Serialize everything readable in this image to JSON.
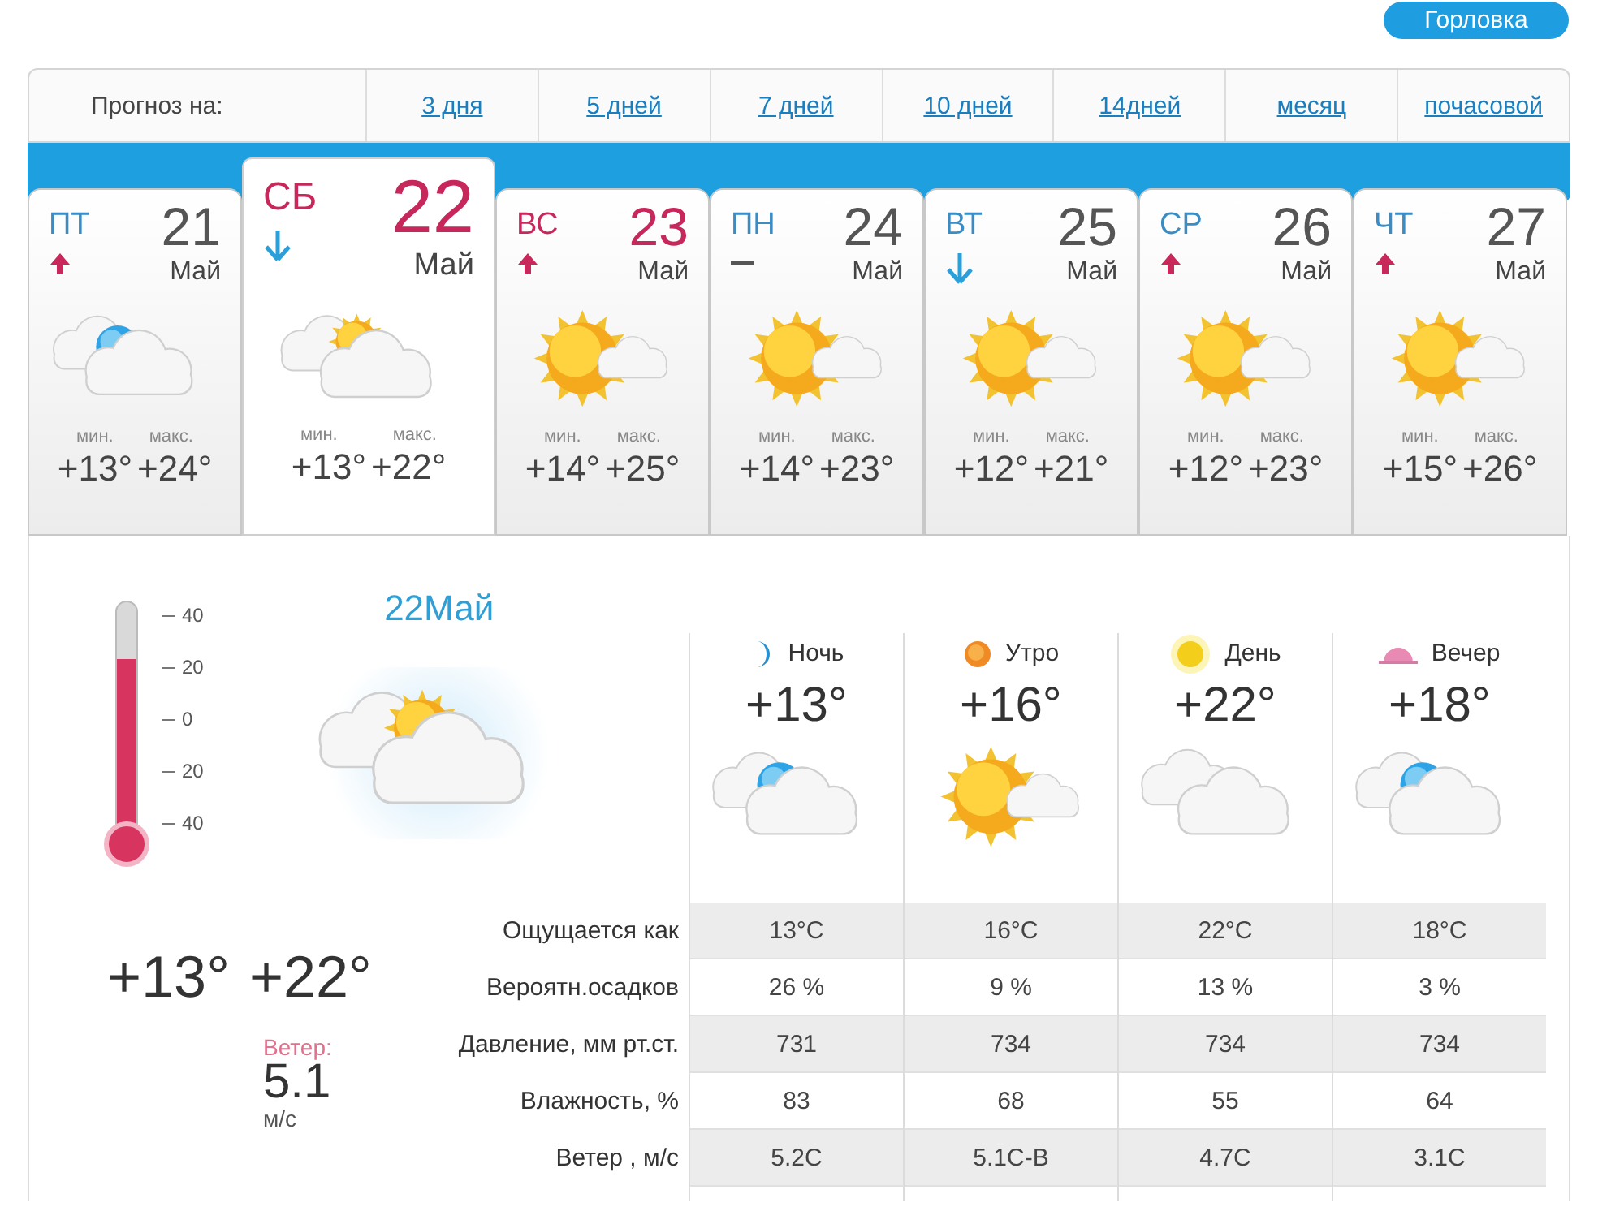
{
  "city_button": "Горловка",
  "forecast_nav": {
    "label": "Прогноз на:",
    "links": [
      {
        "label": "3 дня"
      },
      {
        "label": "5 дней"
      },
      {
        "label": "7 дней"
      },
      {
        "label": "10 дней"
      },
      {
        "label": "14дней"
      },
      {
        "label": "месяц"
      },
      {
        "label": "почасовой"
      }
    ]
  },
  "days": [
    {
      "weekday": "ПТ",
      "date": "21",
      "month": "Май",
      "weekend": false,
      "selected": false,
      "trend": {
        "kind": "up"
      },
      "weather": {
        "kind": "moon-cloud"
      },
      "min_label": "мин.",
      "max_label": "макс.",
      "min": "+13°",
      "max": "+24°"
    },
    {
      "weekday": "СБ",
      "date": "22",
      "month": "Май",
      "weekend": true,
      "selected": true,
      "trend": {
        "kind": "down"
      },
      "weather": {
        "kind": "cloud-sun"
      },
      "min_label": "мин.",
      "max_label": "макс.",
      "min": "+13°",
      "max": "+22°"
    },
    {
      "weekday": "ВС",
      "date": "23",
      "month": "Май",
      "weekend": true,
      "selected": false,
      "trend": {
        "kind": "up"
      },
      "weather": {
        "kind": "sun-cloud"
      },
      "min_label": "мин.",
      "max_label": "макс.",
      "min": "+14°",
      "max": "+25°"
    },
    {
      "weekday": "ПН",
      "date": "24",
      "month": "Май",
      "weekend": false,
      "selected": false,
      "trend": {
        "kind": "flat"
      },
      "weather": {
        "kind": "sun-cloud"
      },
      "min_label": "мин.",
      "max_label": "макс.",
      "min": "+14°",
      "max": "+23°"
    },
    {
      "weekday": "ВТ",
      "date": "25",
      "month": "Май",
      "weekend": false,
      "selected": false,
      "trend": {
        "kind": "down"
      },
      "weather": {
        "kind": "sun-cloud"
      },
      "min_label": "мин.",
      "max_label": "макс.",
      "min": "+12°",
      "max": "+21°"
    },
    {
      "weekday": "СР",
      "date": "26",
      "month": "Май",
      "weekend": false,
      "selected": false,
      "trend": {
        "kind": "up"
      },
      "weather": {
        "kind": "sun-cloud"
      },
      "min_label": "мин.",
      "max_label": "макс.",
      "min": "+12°",
      "max": "+23°"
    },
    {
      "weekday": "ЧТ",
      "date": "27",
      "month": "Май",
      "weekend": false,
      "selected": false,
      "trend": {
        "kind": "up"
      },
      "weather": {
        "kind": "sun-cloud"
      },
      "min_label": "мин.",
      "max_label": "макс.",
      "min": "+15°",
      "max": "+26°"
    }
  ],
  "detail": {
    "date": "22Май",
    "weather": {
      "kind": "cloud-sun"
    },
    "thermometer": {
      "level": 0.75,
      "scale": [
        "40",
        "20",
        "0",
        "20",
        "40"
      ]
    },
    "min": "+13°",
    "max": "+22°",
    "wind_label": "Ветер:",
    "wind_value": "5.1",
    "wind_unit": "м/с"
  },
  "periods": [
    {
      "kind": "night",
      "name": "Ночь",
      "temp": "+13°",
      "weather": {
        "kind": "moon-cloud"
      }
    },
    {
      "kind": "morning",
      "name": "Утро",
      "temp": "+16°",
      "weather": {
        "kind": "sun-cloud"
      }
    },
    {
      "kind": "day",
      "name": "День",
      "temp": "+22°",
      "weather": {
        "kind": "cloudy"
      }
    },
    {
      "kind": "evening",
      "name": "Вечер",
      "temp": "+18°",
      "weather": {
        "kind": "moon-cloud"
      }
    }
  ],
  "table": {
    "rows": [
      {
        "label": "Ощущается как",
        "values": [
          "13°С",
          "16°С",
          "22°С",
          "18°С"
        ]
      },
      {
        "label": "Вероятн.осадков",
        "values": [
          "26 %",
          "9 %",
          "13 %",
          "3 %"
        ]
      },
      {
        "label": "Давление, мм рт.ст.",
        "values": [
          "731",
          "734",
          "734",
          "734"
        ]
      },
      {
        "label": "Влажность, %",
        "values": [
          "83",
          "68",
          "55",
          "64"
        ]
      },
      {
        "label": "Ветер , м/с",
        "values": [
          "5.2С",
          "5.1С-В",
          "4.7С",
          "3.1С"
        ]
      }
    ]
  }
}
